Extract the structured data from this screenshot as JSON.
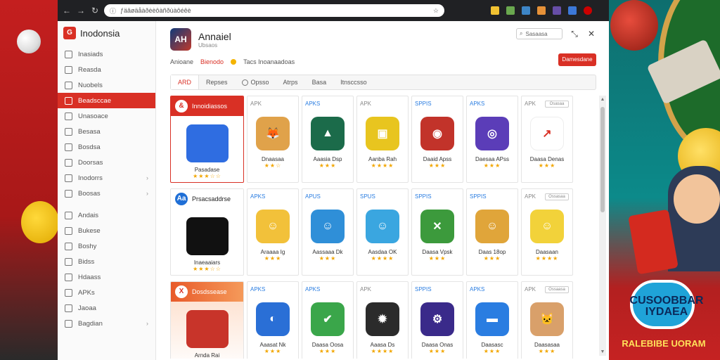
{
  "browser": {
    "url": "ƒäâøäåàðèèôàñðùàôéêè"
  },
  "sidebar": {
    "brand": "Inodonsia",
    "items": [
      {
        "label": "Inasiads",
        "active": false,
        "chevron": false
      },
      {
        "label": "Reasda",
        "active": false,
        "chevron": false
      },
      {
        "label": "Nuobels",
        "active": false,
        "chevron": false
      },
      {
        "label": "Beadsccae",
        "active": true,
        "chevron": false
      },
      {
        "label": "Unasoace",
        "active": false,
        "chevron": false
      },
      {
        "label": "Besasa",
        "active": false,
        "chevron": false
      },
      {
        "label": "Bosdsa",
        "active": false,
        "chevron": false
      },
      {
        "label": "Doorsas",
        "active": false,
        "chevron": false
      },
      {
        "label": "Inodorrs",
        "active": false,
        "chevron": true
      },
      {
        "label": "Boosas",
        "active": false,
        "chevron": true
      }
    ],
    "items2": [
      {
        "label": "Andais",
        "chevron": false
      },
      {
        "label": "Bukese",
        "chevron": false
      },
      {
        "label": "Boshy",
        "chevron": false
      },
      {
        "label": "Bidss",
        "chevron": false
      },
      {
        "label": "Hdaass",
        "chevron": false
      },
      {
        "label": "APKs",
        "chevron": false
      },
      {
        "label": "Jaoaa",
        "chevron": false
      },
      {
        "label": "Bagdian",
        "chevron": true
      }
    ]
  },
  "header": {
    "app_icon_text": "AH",
    "title": "Annaiel",
    "subtitle": "Ubsaos",
    "search_label": "Sasaasa",
    "sub_left": "Anioane",
    "sub_accent": "Bienodo",
    "sub_right": "Tacs Inoanaadoas",
    "install_label": "Damesdane"
  },
  "tabs": [
    {
      "label": "ARD",
      "active": true
    },
    {
      "label": "Repses",
      "active": false
    },
    {
      "label": "Opsso",
      "active": false
    },
    {
      "label": "Atrps",
      "active": false
    },
    {
      "label": "Basa",
      "active": false
    },
    {
      "label": "Itnsccsso",
      "active": false
    }
  ],
  "featured": [
    {
      "badge": "&",
      "title": "Innoidiassos",
      "name": "Pasadase",
      "stars": "★★★☆☆",
      "style": "f1",
      "color": "#2f6de1"
    },
    {
      "badge": "Aa",
      "title": "Prsacsaddrse",
      "name": "Inaeaaiars",
      "stars": "★★★☆☆",
      "style": "f2",
      "color": "#111111"
    },
    {
      "badge": "X",
      "title": "Dosdssease",
      "name": "Arnda Rai",
      "stars": "★★★☆☆",
      "style": "f3",
      "color": "#c8342a"
    }
  ],
  "apps": [
    [
      {
        "tag": "APK",
        "name": "Dnaasaa",
        "stars": "★★☆",
        "color": "#e0a24a",
        "glyph": "🦊"
      },
      {
        "tag": "APKS",
        "name": "Aaasia Dsp",
        "stars": "★★★",
        "color": "#1b6b4a",
        "glyph": "▲"
      },
      {
        "tag": "APK",
        "name": "Aanba Rah",
        "stars": "★★★★",
        "color": "#e8c51f",
        "glyph": "▣"
      },
      {
        "tag": "SPPIS",
        "name": "Daaid Apss",
        "stars": "★★★",
        "color": "#c2332a",
        "glyph": "◉"
      },
      {
        "tag": "APKS",
        "name": "Daesaa APss",
        "stars": "★★★",
        "color": "#5b3db8",
        "glyph": "◎"
      },
      {
        "tag": "APK",
        "name": "Daasa Denas",
        "stars": "★★★",
        "color": "#ffffff",
        "glyph": "↗",
        "option": "Osasaa"
      }
    ],
    [
      {
        "tag": "APKS",
        "name": "Araaaa Ig",
        "stars": "★★★",
        "color": "#f2c13a",
        "glyph": "☺"
      },
      {
        "tag": "APUS",
        "name": "Aassaaa Dk",
        "stars": "★★★",
        "color": "#2f8fd8",
        "glyph": "☺"
      },
      {
        "tag": "SPUS",
        "name": "Aasdaa OK",
        "stars": "★★★★",
        "color": "#3aa6e0",
        "glyph": "☺"
      },
      {
        "tag": "SPPIS",
        "name": "Daasa Vpsk",
        "stars": "★★★",
        "color": "#3c9a3c",
        "glyph": "✕"
      },
      {
        "tag": "SPPIS",
        "name": "Daas 18op",
        "stars": "★★★",
        "color": "#e0a53a",
        "glyph": "☺"
      },
      {
        "tag": "APK",
        "name": "Daasaan",
        "stars": "★★★★",
        "color": "#f2d23a",
        "glyph": "☺",
        "option": "Ossasaa"
      }
    ],
    [
      {
        "tag": "APKS",
        "name": "Aaasat Nk",
        "stars": "★★★",
        "color": "#2a6fd6",
        "glyph": "◐"
      },
      {
        "tag": "APKS",
        "name": "Daasa Oosa",
        "stars": "★★★",
        "color": "#3aa64a",
        "glyph": "✔"
      },
      {
        "tag": "APK",
        "name": "Aaasa Ds",
        "stars": "★★★★",
        "color": "#2b2b2b",
        "glyph": "✹"
      },
      {
        "tag": "SPPIS",
        "name": "Daasa Onas",
        "stars": "★★★",
        "color": "#3a2a8a",
        "glyph": "⚙"
      },
      {
        "tag": "APKS",
        "name": "Daasasc",
        "stars": "★★★",
        "color": "#2a7de1",
        "glyph": "▬"
      },
      {
        "tag": "APK",
        "name": "Daasasaa",
        "stars": "★★★",
        "color": "#d9a06a",
        "glyph": "🐱",
        "option": "Ossaasa"
      }
    ]
  ],
  "promo": {
    "title": "CUSOOBBAR IYDAEA",
    "sub": "RALEBIBE UORAM"
  },
  "colors": {
    "accent": "#d93025",
    "star": "#f2a600",
    "link": "#2a7de1"
  }
}
